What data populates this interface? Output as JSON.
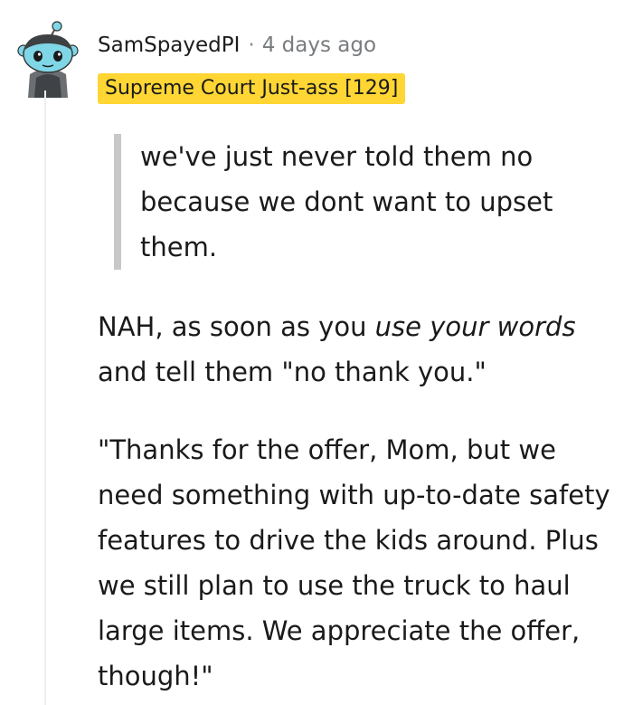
{
  "comment": {
    "username": "SamSpayedPI",
    "separator": "·",
    "timestamp": "4 days ago",
    "flair": {
      "text": "Supreme Court Just-ass [129]",
      "background": "#ffd633"
    },
    "avatar_icon": "reddit-snoo-avatar",
    "quote": "we've just never told them no because we dont want to upset them.",
    "paragraph1": {
      "before": "NAH, as soon as you ",
      "emphasis": "use your words",
      "after": " and tell them \"no thank you.\""
    },
    "paragraph2": "\"Thanks for the offer, Mom, but we need something with up-to-date safety features to drive the kids around. Plus we still plan to use the truck to haul large items. We appreciate the offer, though!\""
  },
  "colors": {
    "flair_bg": "#ffd633",
    "quote_bar": "#c8c8c8",
    "thread_line": "#edeff1",
    "meta_text": "#787c7e"
  }
}
